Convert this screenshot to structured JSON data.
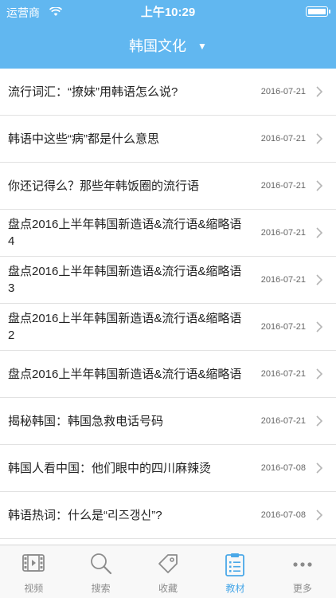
{
  "status": {
    "carrier": "运营商",
    "time": "上午10:29"
  },
  "header": {
    "title": "韩国文化"
  },
  "list": [
    {
      "title": "流行词汇：“撩妹”用韩语怎么说?",
      "date": "2016-07-21"
    },
    {
      "title": "韩语中这些“病”都是什么意思",
      "date": "2016-07-21"
    },
    {
      "title": "你还记得么？那些年韩饭圈的流行语",
      "date": "2016-07-21"
    },
    {
      "title": "盘点2016上半年韩国新造语&流行语&缩略语 4",
      "date": "2016-07-21"
    },
    {
      "title": "盘点2016上半年韩国新造语&流行语&缩略语 3",
      "date": "2016-07-21"
    },
    {
      "title": "盘点2016上半年韩国新造语&流行语&缩略语 2",
      "date": "2016-07-21"
    },
    {
      "title": "盘点2016上半年韩国新造语&流行语&缩略语",
      "date": "2016-07-21"
    },
    {
      "title": "揭秘韩国：韩国急救电话号码",
      "date": "2016-07-21"
    },
    {
      "title": "韩国人看中国：他们眼中的四川麻辣烫",
      "date": "2016-07-08"
    },
    {
      "title": "韩语热词：什么是“리즈갱신”?",
      "date": "2016-07-08"
    }
  ],
  "tabs": [
    {
      "label": "视频",
      "icon": "film-icon"
    },
    {
      "label": "搜索",
      "icon": "search-icon"
    },
    {
      "label": "收藏",
      "icon": "tag-icon"
    },
    {
      "label": "教材",
      "icon": "clipboard-icon",
      "active": true
    },
    {
      "label": "更多",
      "icon": "more-icon"
    }
  ],
  "colors": {
    "header_bg": "#61b7f0",
    "active_tab": "#4aa8e8"
  }
}
